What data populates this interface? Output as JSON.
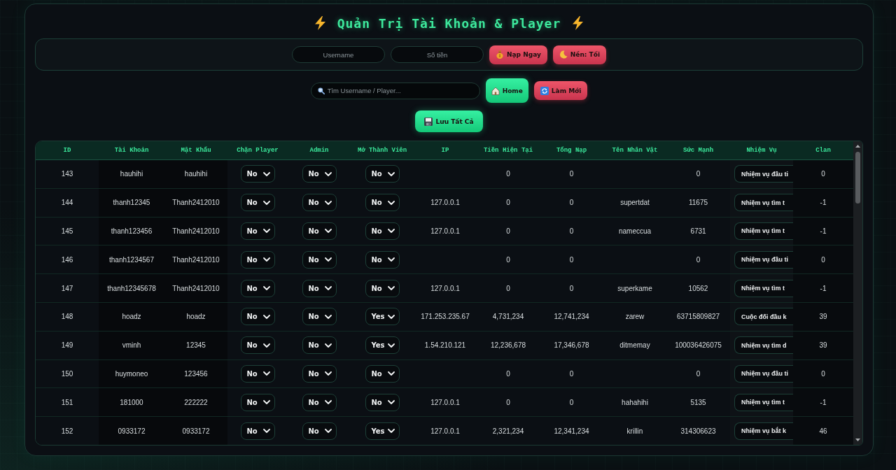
{
  "title": "Quản Trị Tài Khoản & Player",
  "topup_form": {
    "username": {
      "placeholder": "Username"
    },
    "amount": {
      "placeholder": "Số tiền"
    },
    "buttons": [
      {
        "label": "Nạp Ngay",
        "kind": "danger"
      },
      {
        "label": "Nền: Tối",
        "kind": "danger"
      }
    ]
  },
  "toolbar": {
    "search": {
      "placeholder": "Tìm Username / Player..."
    },
    "buttons": [
      {
        "label": "Home",
        "kind": "primary"
      },
      {
        "label": "Làm Mới",
        "kind": "danger"
      }
    ]
  },
  "save_button": {
    "label": "Lưu Tất Cả",
    "kind": "primary"
  },
  "table": {
    "columns": [
      {
        "label": "ID",
        "kind": "text"
      },
      {
        "label": "Tài Khoản",
        "kind": "text"
      },
      {
        "label": "Mật Khẩu",
        "kind": "text"
      },
      {
        "label": "Chặn Player",
        "kind": "select"
      },
      {
        "label": "Admin",
        "kind": "select"
      },
      {
        "label": "Mở Thành Viên",
        "kind": "select"
      },
      {
        "label": "IP",
        "kind": "text"
      },
      {
        "label": "Tiền Hiện Tại",
        "kind": "text"
      },
      {
        "label": "Tổng Nạp",
        "kind": "text"
      },
      {
        "label": "Tên Nhân Vật",
        "kind": "text"
      },
      {
        "label": "Sức Mạnh",
        "kind": "text"
      },
      {
        "label": "Nhiệm Vụ",
        "kind": "quest"
      },
      {
        "label": "Clan",
        "kind": "text"
      }
    ],
    "rows": [
      {
        "id": "143",
        "account": "hauhihi",
        "password": "hauhihi",
        "block_player": "No",
        "admin": "No",
        "member": "No",
        "money": "0",
        "total_topup": "0",
        "power": "0",
        "quest": "Nhiệm vụ đầu ti",
        "clan": "0"
      },
      {
        "id": "144",
        "account": "thanh12345",
        "password": "Thanh2412010",
        "block_player": "No",
        "admin": "No",
        "member": "No",
        "ip": "127.0.0.1",
        "money": "0",
        "total_topup": "0",
        "character": "supertdat",
        "power": "11675",
        "quest": "Nhiệm vụ tìm t",
        "clan": "-1"
      },
      {
        "id": "145",
        "account": "thanh123456",
        "password": "Thanh2412010",
        "block_player": "No",
        "admin": "No",
        "member": "No",
        "ip": "127.0.0.1",
        "money": "0",
        "total_topup": "0",
        "character": "nameccua",
        "power": "6731",
        "quest": "Nhiệm vụ tìm t",
        "clan": "-1"
      },
      {
        "id": "146",
        "account": "thanh1234567",
        "password": "Thanh2412010",
        "block_player": "No",
        "admin": "No",
        "member": "No",
        "money": "0",
        "total_topup": "0",
        "power": "0",
        "quest": "Nhiệm vụ đầu ti",
        "clan": "0"
      },
      {
        "id": "147",
        "account": "thanh12345678",
        "password": "Thanh2412010",
        "block_player": "No",
        "admin": "No",
        "member": "No",
        "ip": "127.0.0.1",
        "money": "0",
        "total_topup": "0",
        "character": "superkame",
        "power": "10562",
        "quest": "Nhiệm vụ tìm t",
        "clan": "-1"
      },
      {
        "id": "148",
        "account": "hoadz",
        "password": "hoadz",
        "block_player": "No",
        "admin": "No",
        "member": "Yes",
        "ip": "171.253.235.67",
        "money": "4,731,234",
        "total_topup": "12,741,234",
        "character": "zarew",
        "power": "63715809827",
        "quest": "Cuộc đối đầu k",
        "clan": "39"
      },
      {
        "id": "149",
        "account": "vminh",
        "password": "12345",
        "block_player": "No",
        "admin": "No",
        "member": "Yes",
        "ip": "1.54.210.121",
        "money": "12,236,678",
        "total_topup": "17,346,678",
        "character": "ditmemay",
        "power": "100036426075",
        "quest": "Nhiệm vụ tìm d",
        "clan": "39"
      },
      {
        "id": "150",
        "account": "huymoneo",
        "password": "123456",
        "block_player": "No",
        "admin": "No",
        "member": "No",
        "money": "0",
        "total_topup": "0",
        "power": "0",
        "quest": "Nhiệm vụ đầu ti",
        "clan": "0"
      },
      {
        "id": "151",
        "account": "181000",
        "password": "222222",
        "block_player": "No",
        "admin": "No",
        "member": "No",
        "ip": "127.0.0.1",
        "money": "0",
        "total_topup": "0",
        "character": "hahahihi",
        "power": "5135",
        "quest": "Nhiệm vụ tìm t",
        "clan": "-1"
      },
      {
        "id": "152",
        "account": "0933172",
        "password": "0933172",
        "block_player": "No",
        "admin": "No",
        "member": "Yes",
        "ip": "127.0.0.1",
        "money": "2,321,234",
        "total_topup": "12,341,234",
        "character": "krillin",
        "power": "314306623",
        "quest": "Nhiệm vụ bắt k",
        "clan": "46"
      }
    ]
  }
}
